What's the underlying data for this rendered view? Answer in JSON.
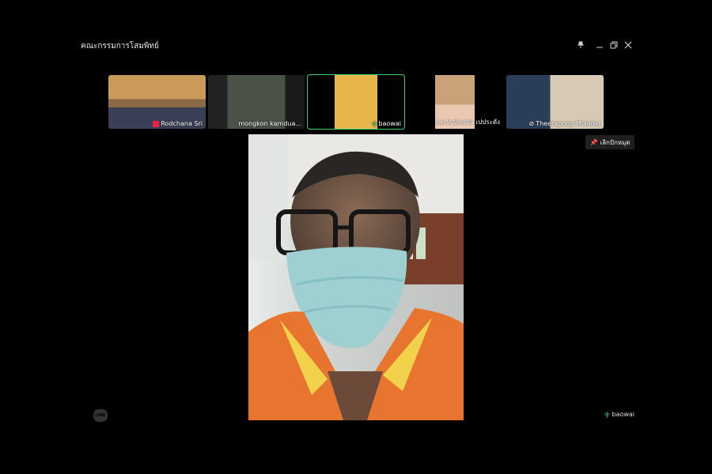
{
  "window": {
    "title": "คณะกรรมการโสมพิทย์",
    "pin_icon": "pin-icon",
    "minimize_icon": "minimize-icon",
    "restore_icon": "restore-icon",
    "close_icon": "close-icon"
  },
  "participants": [
    {
      "name": "Rodchana Sri",
      "mic": "muted"
    },
    {
      "name": "mongkon  kamdua...",
      "mic": "none"
    },
    {
      "name": "baowai",
      "mic": "speaking",
      "active": true
    },
    {
      "name": "ร.ต.ท.ประเจน เปประดัง",
      "mic": "none"
    },
    {
      "name": "Theerapong Moladej",
      "mic": "video-off"
    }
  ],
  "unpin_button": {
    "label": "เลิกปักหมุด"
  },
  "speaker": {
    "name": "baowai"
  },
  "app_logo": {
    "text": "LINE"
  },
  "colors": {
    "active_border": "#3bd16f",
    "background": "#000000"
  }
}
